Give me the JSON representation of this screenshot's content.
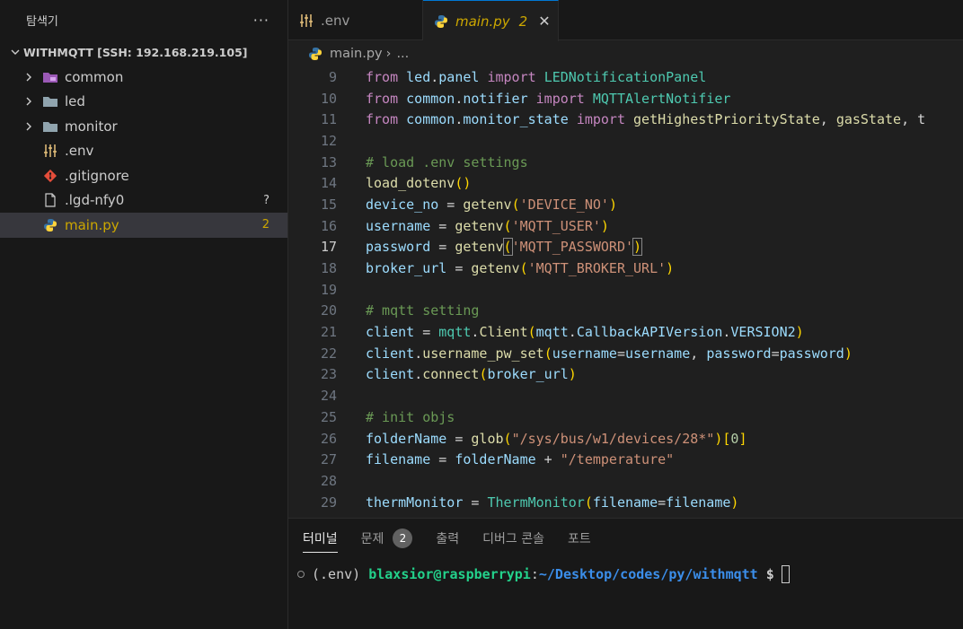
{
  "sidebar": {
    "title": "탐색기",
    "more": "···",
    "root": "WITHMQTT [SSH: 192.168.219.105]",
    "items": [
      {
        "label": "common",
        "badge": ""
      },
      {
        "label": "led",
        "badge": ""
      },
      {
        "label": "monitor",
        "badge": ""
      },
      {
        "label": ".env",
        "badge": ""
      },
      {
        "label": ".gitignore",
        "badge": ""
      },
      {
        "label": ".lgd-nfy0",
        "badge": "?"
      },
      {
        "label": "main.py",
        "badge": "2"
      }
    ]
  },
  "tabs": [
    {
      "label": ".env"
    },
    {
      "label": "main.py",
      "problems": "2",
      "close": "✕"
    }
  ],
  "breadcrumb": {
    "file": "main.py",
    "sep": "›",
    "more": "..."
  },
  "editor": {
    "current_line": 17,
    "lines": [
      {
        "n": "9",
        "tokens": [
          [
            "kw",
            "from "
          ],
          [
            "var",
            "led"
          ],
          [
            "code",
            "."
          ],
          [
            "var",
            "panel "
          ],
          [
            "kw",
            "import "
          ],
          [
            "cls",
            "LEDNotificationPanel"
          ]
        ]
      },
      {
        "n": "10",
        "tokens": [
          [
            "kw",
            "from "
          ],
          [
            "var",
            "common"
          ],
          [
            "code",
            "."
          ],
          [
            "var",
            "notifier "
          ],
          [
            "kw",
            "import "
          ],
          [
            "cls",
            "MQTTAlertNotifier"
          ]
        ]
      },
      {
        "n": "11",
        "tokens": [
          [
            "kw",
            "from "
          ],
          [
            "var",
            "common"
          ],
          [
            "code",
            "."
          ],
          [
            "var",
            "monitor_state "
          ],
          [
            "kw",
            "import "
          ],
          [
            "fn",
            "getHighestPriorityState"
          ],
          [
            "code",
            ", "
          ],
          [
            "fn",
            "gasState"
          ],
          [
            "code",
            ", t"
          ]
        ]
      },
      {
        "n": "12",
        "tokens": []
      },
      {
        "n": "13",
        "tokens": [
          [
            "cmt",
            "# load .env settings"
          ]
        ]
      },
      {
        "n": "14",
        "tokens": [
          [
            "fn",
            "load_dotenv"
          ],
          [
            "p1",
            "()"
          ]
        ]
      },
      {
        "n": "15",
        "tokens": [
          [
            "var",
            "device_no"
          ],
          [
            "code",
            " = "
          ],
          [
            "fn",
            "getenv"
          ],
          [
            "p1",
            "("
          ],
          [
            "str",
            "'DEVICE_NO'"
          ],
          [
            "p1",
            ")"
          ]
        ]
      },
      {
        "n": "16",
        "tokens": [
          [
            "var",
            "username"
          ],
          [
            "code",
            " = "
          ],
          [
            "fn",
            "getenv"
          ],
          [
            "p1",
            "("
          ],
          [
            "str",
            "'MQTT_USER'"
          ],
          [
            "p1",
            ")"
          ]
        ]
      },
      {
        "n": "17",
        "tokens": [
          [
            "var",
            "password"
          ],
          [
            "code",
            " = "
          ],
          [
            "fn",
            "getenv"
          ],
          [
            "p1m",
            "("
          ],
          [
            "str",
            "'MQTT_PASSWORD'"
          ],
          [
            "p1m",
            ")"
          ]
        ]
      },
      {
        "n": "18",
        "tokens": [
          [
            "var",
            "broker_url"
          ],
          [
            "code",
            " = "
          ],
          [
            "fn",
            "getenv"
          ],
          [
            "p1",
            "("
          ],
          [
            "str",
            "'MQTT_BROKER_URL'"
          ],
          [
            "p1",
            ")"
          ]
        ]
      },
      {
        "n": "19",
        "tokens": []
      },
      {
        "n": "20",
        "tokens": [
          [
            "cmt",
            "# mqtt setting"
          ]
        ]
      },
      {
        "n": "21",
        "tokens": [
          [
            "var",
            "client"
          ],
          [
            "code",
            " = "
          ],
          [
            "cls",
            "mqtt"
          ],
          [
            "code",
            "."
          ],
          [
            "fn",
            "Client"
          ],
          [
            "p1",
            "("
          ],
          [
            "var",
            "mqtt"
          ],
          [
            "code",
            "."
          ],
          [
            "var",
            "CallbackAPIVersion"
          ],
          [
            "code",
            "."
          ],
          [
            "var",
            "VERSION2"
          ],
          [
            "p1",
            ")"
          ]
        ]
      },
      {
        "n": "22",
        "tokens": [
          [
            "var",
            "client"
          ],
          [
            "code",
            "."
          ],
          [
            "fn",
            "username_pw_set"
          ],
          [
            "p1",
            "("
          ],
          [
            "var",
            "username"
          ],
          [
            "code",
            "="
          ],
          [
            "var",
            "username"
          ],
          [
            "code",
            ", "
          ],
          [
            "var",
            "password"
          ],
          [
            "code",
            "="
          ],
          [
            "var",
            "password"
          ],
          [
            "p1",
            ")"
          ]
        ]
      },
      {
        "n": "23",
        "tokens": [
          [
            "var",
            "client"
          ],
          [
            "code",
            "."
          ],
          [
            "fn",
            "connect"
          ],
          [
            "p1",
            "("
          ],
          [
            "var",
            "broker_url"
          ],
          [
            "p1",
            ")"
          ]
        ]
      },
      {
        "n": "24",
        "tokens": []
      },
      {
        "n": "25",
        "tokens": [
          [
            "cmt",
            "# init objs"
          ]
        ]
      },
      {
        "n": "26",
        "tokens": [
          [
            "var",
            "folderName"
          ],
          [
            "code",
            " = "
          ],
          [
            "fn",
            "glob"
          ],
          [
            "p1",
            "("
          ],
          [
            "str",
            "\"/sys/bus/w1/devices/28*\""
          ],
          [
            "p1",
            ")"
          ],
          [
            "p1",
            "["
          ],
          [
            "num",
            "0"
          ],
          [
            "p1",
            "]"
          ]
        ]
      },
      {
        "n": "27",
        "tokens": [
          [
            "var",
            "filename"
          ],
          [
            "code",
            " = "
          ],
          [
            "var",
            "folderName"
          ],
          [
            "code",
            " + "
          ],
          [
            "str",
            "\"/temperature\""
          ]
        ]
      },
      {
        "n": "28",
        "tokens": []
      },
      {
        "n": "29",
        "tokens": [
          [
            "var",
            "thermMonitor"
          ],
          [
            "code",
            " = "
          ],
          [
            "cls",
            "ThermMonitor"
          ],
          [
            "p1",
            "("
          ],
          [
            "var",
            "filename"
          ],
          [
            "code",
            "="
          ],
          [
            "var",
            "filename"
          ],
          [
            "p1",
            ")"
          ]
        ]
      }
    ]
  },
  "panel": {
    "tabs": [
      {
        "label": "터미널"
      },
      {
        "label": "문제",
        "count": "2"
      },
      {
        "label": "출력"
      },
      {
        "label": "디버그 콘솔"
      },
      {
        "label": "포트"
      }
    ],
    "terminal": {
      "env": "(.env) ",
      "user": "blaxsior@raspberrypi",
      "colon": ":",
      "path": "~/Desktop/codes/py/withmqtt",
      "dollar": " $"
    }
  },
  "colors": {
    "accent": "#0078d4",
    "warning": "#cca700",
    "terminal_user": "#23d18b",
    "terminal_path": "#3b8eea"
  },
  "icons": {
    "folder_common": "folder-icon-purple",
    "folder": "folder-icon",
    "env": "settings-sliders-icon",
    "gitignore": "git-icon",
    "file": "file-icon",
    "python": "python-icon"
  }
}
